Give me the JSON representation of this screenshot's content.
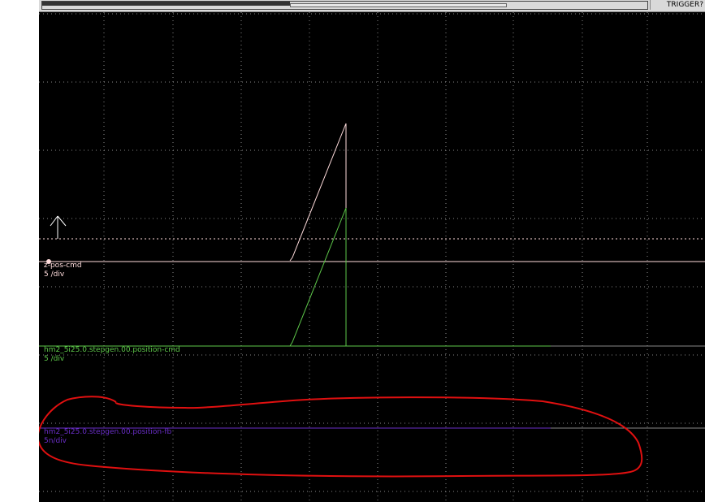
{
  "toolbar": {
    "trigger_label": "TRIGGER?"
  },
  "colors": {
    "background": "#000000",
    "grid": "#8a8a8a",
    "channel1": "#ffdcdc",
    "channel2": "#5ec84a",
    "channel3": "#6a2ec8",
    "annotation": "#e01010"
  },
  "channels": [
    {
      "name": "z-pos-cmd",
      "scale": "5 /div"
    },
    {
      "name": "hm2_5i25.0.stepgen.00.position-cmd",
      "scale": "5 /div"
    },
    {
      "name": "hm2_5i25.0.stepgen.00.position-fb",
      "scale": "5n/div"
    }
  ],
  "icons": {
    "trigger_marker": "up-arrow-icon"
  }
}
